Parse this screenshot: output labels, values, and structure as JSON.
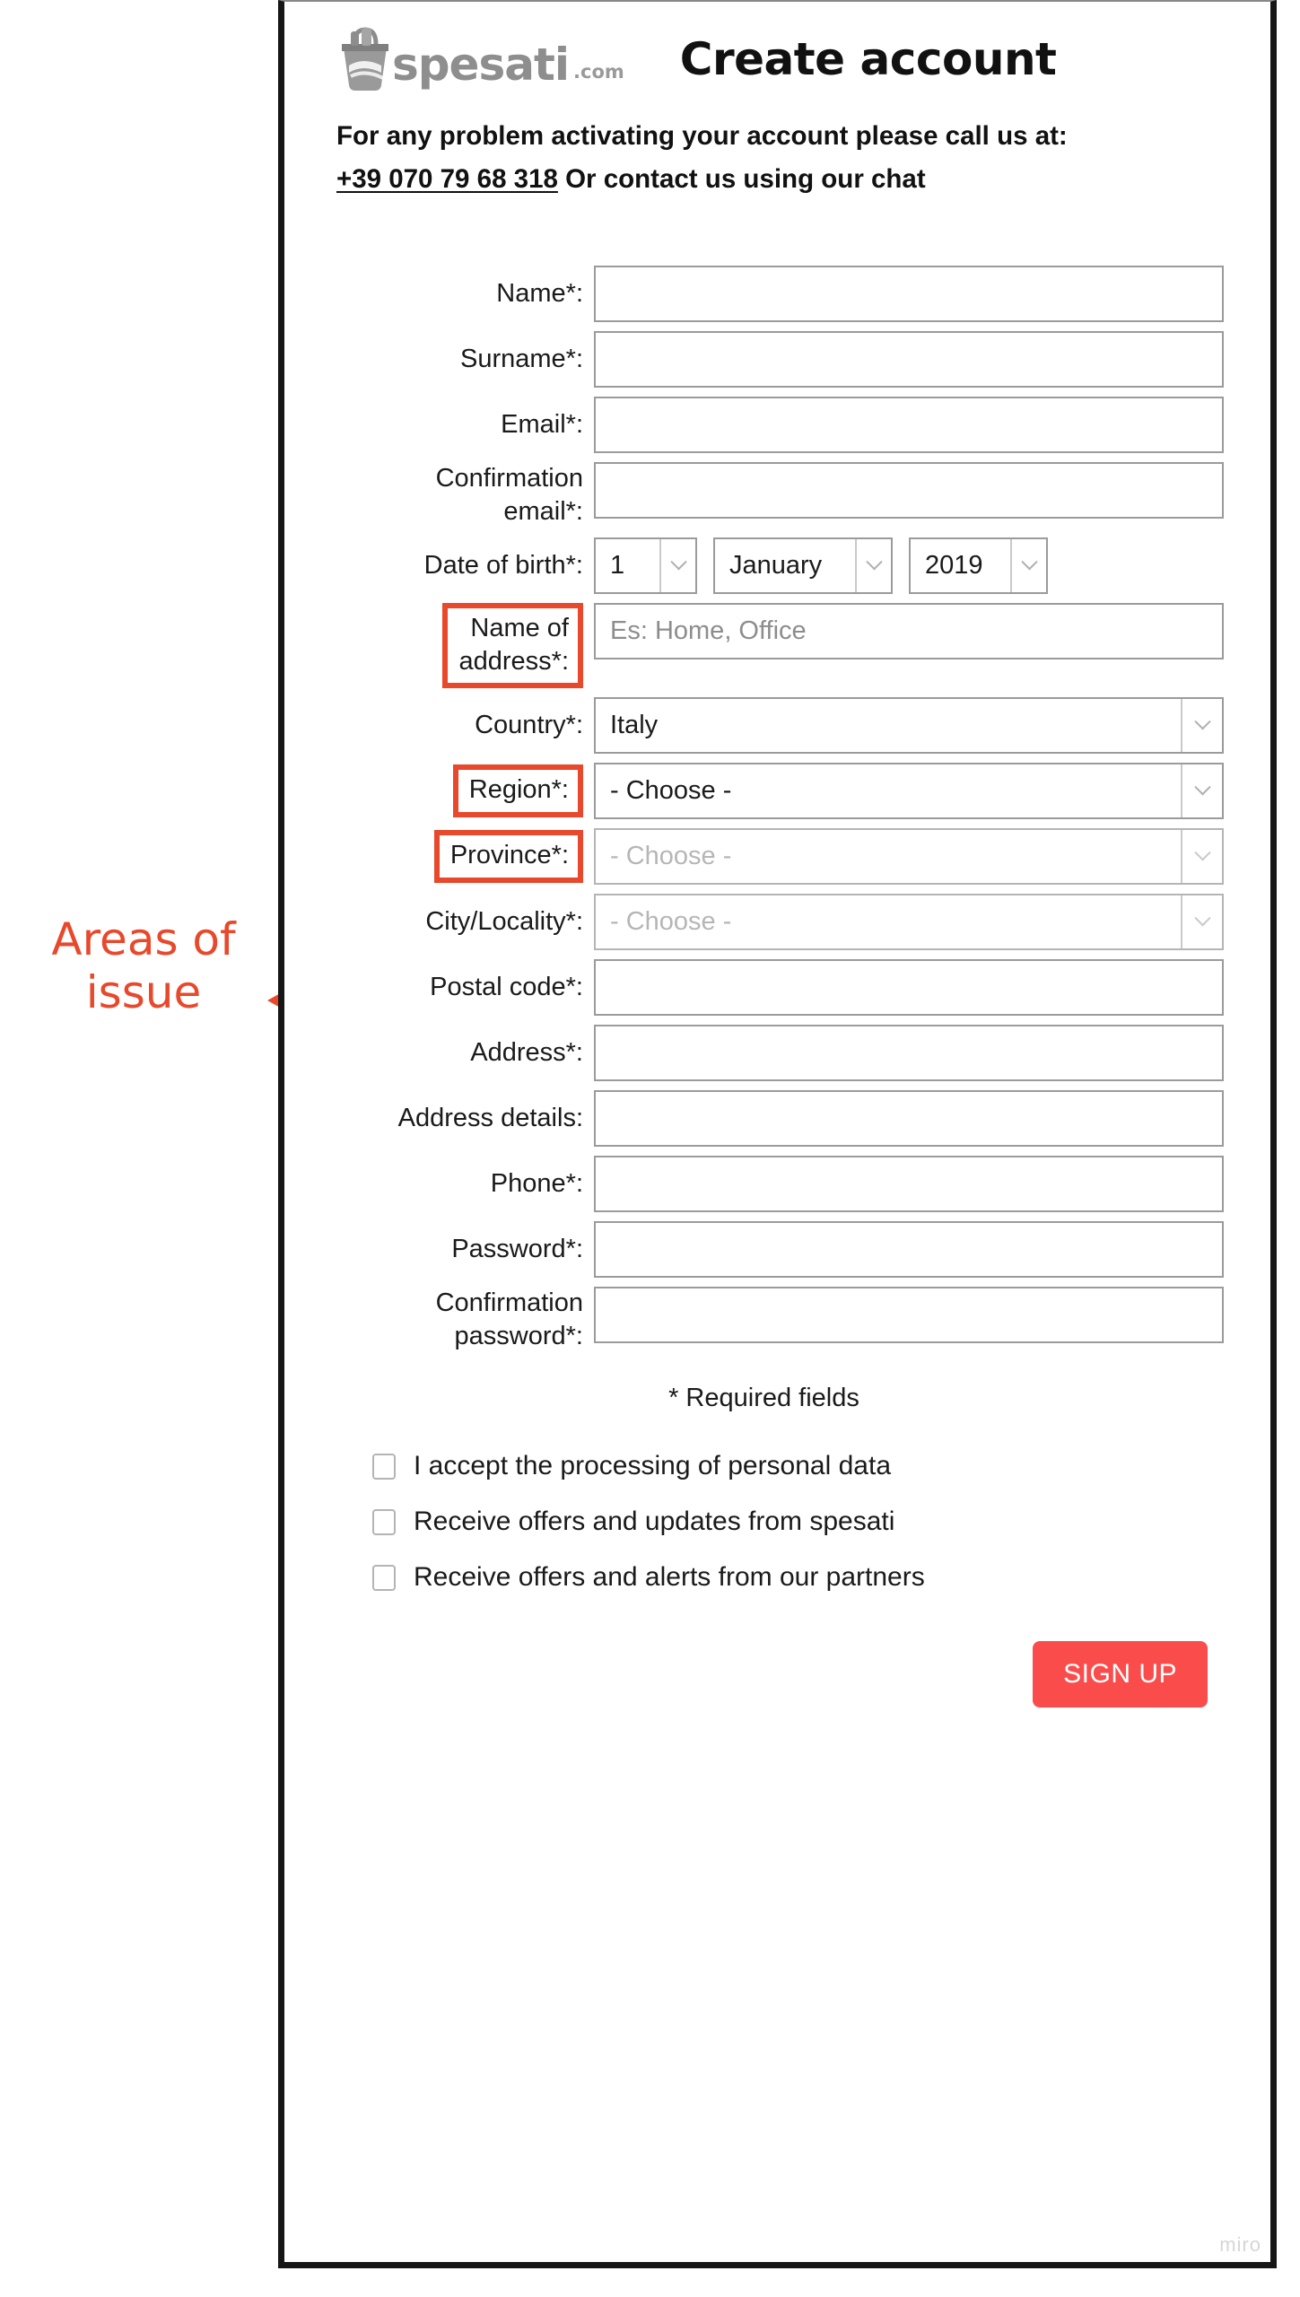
{
  "annotation": {
    "label": "Areas of\nissue",
    "color": "#E8482B",
    "arrow": "curly-brace-arrow-left",
    "targets": [
      "Name of address*:",
      "Region*:",
      "Province*:"
    ]
  },
  "header": {
    "logo_word": "spesati",
    "logo_tld": ".com",
    "logo_icon": "shopping-basket-icon",
    "title": "Create account"
  },
  "help": {
    "line1": "For any problem activating your account please call us at:",
    "phone": "+39 070 79 68 318",
    "line2_rest": " Or contact us using our chat"
  },
  "form": {
    "fields": [
      {
        "label": "Name*:",
        "type": "text",
        "value": "",
        "highlight": false
      },
      {
        "label": "Surname*:",
        "type": "text",
        "value": "",
        "highlight": false
      },
      {
        "label": "Email*:",
        "type": "text",
        "value": "",
        "highlight": false
      },
      {
        "label": "Confirmation\nemail*:",
        "type": "text",
        "value": "",
        "highlight": false
      },
      {
        "label": "Date of birth*:",
        "type": "dob",
        "value": "",
        "highlight": false
      },
      {
        "label": "Name of\naddress*:",
        "type": "text",
        "value": "Es: Home, Office",
        "placeholder": true,
        "highlight": true
      },
      {
        "label": "Country*:",
        "type": "select",
        "value": "Italy",
        "disabled": false,
        "highlight": false
      },
      {
        "label": "Region*:",
        "type": "select",
        "value": "- Choose -",
        "disabled": false,
        "highlight": true
      },
      {
        "label": "Province*:",
        "type": "select",
        "value": "- Choose -",
        "disabled": true,
        "highlight": true
      },
      {
        "label": "City/Locality*:",
        "type": "select",
        "value": "- Choose -",
        "disabled": true,
        "highlight": false
      },
      {
        "label": "Postal code*:",
        "type": "text",
        "value": "",
        "highlight": false
      },
      {
        "label": "Address*:",
        "type": "text",
        "value": "",
        "highlight": false
      },
      {
        "label": "Address details:",
        "type": "text",
        "value": "",
        "highlight": false
      },
      {
        "label": "Phone*:",
        "type": "text",
        "value": "",
        "highlight": false
      },
      {
        "label": "Password*:",
        "type": "text",
        "value": "",
        "highlight": false
      },
      {
        "label": "Confirmation\npassword*:",
        "type": "text",
        "value": "",
        "highlight": false
      }
    ],
    "dob": {
      "day": "1",
      "month": "January",
      "year": "2019"
    },
    "required_note": "* Required fields"
  },
  "consents": [
    {
      "label": "I accept the processing of personal data",
      "checked": false
    },
    {
      "label": "Receive offers and updates from spesati",
      "checked": false
    },
    {
      "label": "Receive offers and alerts from our partners",
      "checked": false
    }
  ],
  "submit": {
    "label": "SIGN UP",
    "color": "#FB4C4C"
  },
  "watermark": "miro"
}
